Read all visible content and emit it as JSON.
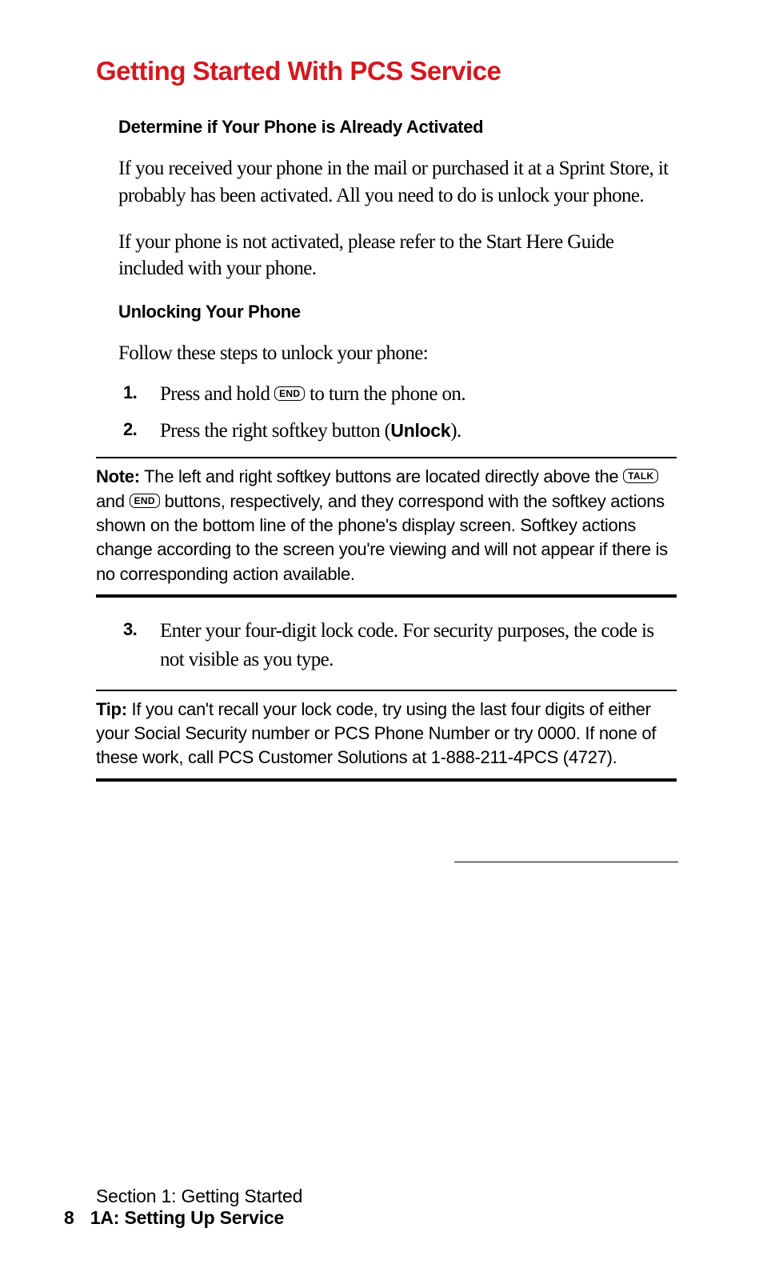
{
  "title": "Getting Started With PCS Service",
  "section1": {
    "heading": "Determine if Your Phone is Already Activated",
    "para1": "If you received your phone in the mail or purchased it at a Sprint Store, it probably has been activated. All you need to do is unlock your phone.",
    "para2": "If your phone is not activated, please refer to the Start Here Guide included with your phone."
  },
  "section2": {
    "heading": "Unlocking Your Phone",
    "intro": "Follow these steps to unlock your phone:",
    "step1_num": "1.",
    "step1_a": "Press and hold ",
    "step1_key": "END",
    "step1_b": " to turn the phone on.",
    "step2_num": "2.",
    "step2_a": "Press the right softkey button (",
    "step2_bold": "Unlock",
    "step2_b": ")."
  },
  "note": {
    "label": "Note:",
    "text_a": " The left and right softkey buttons are located directly above the ",
    "key1": "TALK",
    "text_b": " and ",
    "key2": "END",
    "text_c": " buttons, respectively, and they correspond with the softkey actions shown on the bottom line of the phone's display screen. Softkey actions change according to the screen you're viewing and will not appear if there is no corresponding action available."
  },
  "step3": {
    "num": "3.",
    "text": "Enter your four-digit lock code. For security purposes, the code is not visible as you type."
  },
  "tip": {
    "label": "Tip:",
    "text": " If you can't recall your lock code, try using the last four digits of either your Social Security number or PCS Phone Number or try 0000. If none of these work, call PCS Customer Solutions at 1-888-211-4PCS (4727)."
  },
  "footer": {
    "section": "Section 1: Getting Started",
    "page": "8",
    "subsection": "1A: Setting Up Service"
  }
}
